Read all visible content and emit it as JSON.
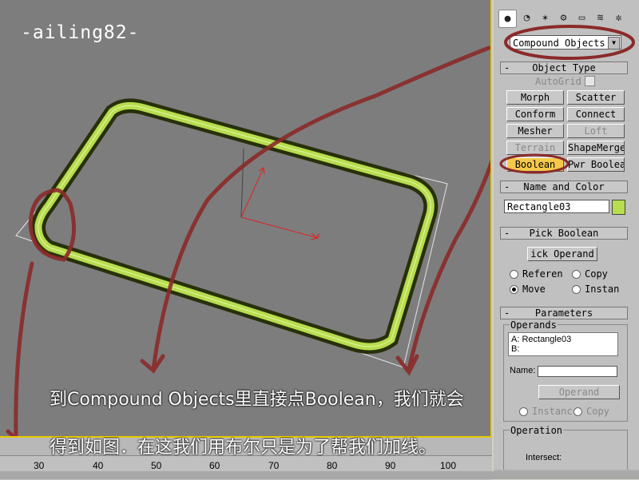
{
  "viewport": {
    "title": "-ailing82-",
    "axis_x": "x"
  },
  "panel": {
    "tabs": [
      "create-icon",
      "modify-icon",
      "hierarchy-icon",
      "motion-icon",
      "display-icon",
      "utilities-icon",
      "systems-icon"
    ],
    "category": "Compound Objects",
    "object_type": {
      "header": "Object Type",
      "autogrid": "AutoGrid",
      "buttons": [
        "Morph",
        "Scatter",
        "Conform",
        "Connect",
        "Mesher",
        "Loft",
        "Terrain",
        "ShapeMerge",
        "Boolean",
        "Pwr Boolean"
      ]
    },
    "name_color": {
      "header": "Name and Color",
      "name": "Rectangle03",
      "color": "#b7dd4e"
    },
    "pick_boolean": {
      "header": "Pick Boolean",
      "button": "ick Operand",
      "options": [
        "Referen",
        "Copy",
        "Move",
        "Instan"
      ]
    },
    "parameters": {
      "header": "Parameters",
      "operands_label": "Operands",
      "operands": [
        "A: Rectangle03",
        "B:"
      ],
      "name_label": "Name:",
      "extract_button": "Operand",
      "extract_options": [
        "Instanc",
        "Copy"
      ],
      "operation_label": "Operation",
      "operation_first": "Intersect:"
    }
  },
  "timeline": {
    "ticks": [
      "30",
      "40",
      "50",
      "60",
      "70",
      "80",
      "90",
      "100"
    ]
  },
  "captions": {
    "line1": "到Compound Objects里直接点Boolean，我们就会",
    "line2": "得到如图．在这我们用布尔只是为了帮我们加线。"
  },
  "colors": {
    "accent": "#e8c800",
    "annotation": "#8b2a2a",
    "object": "#b7dd4e"
  }
}
